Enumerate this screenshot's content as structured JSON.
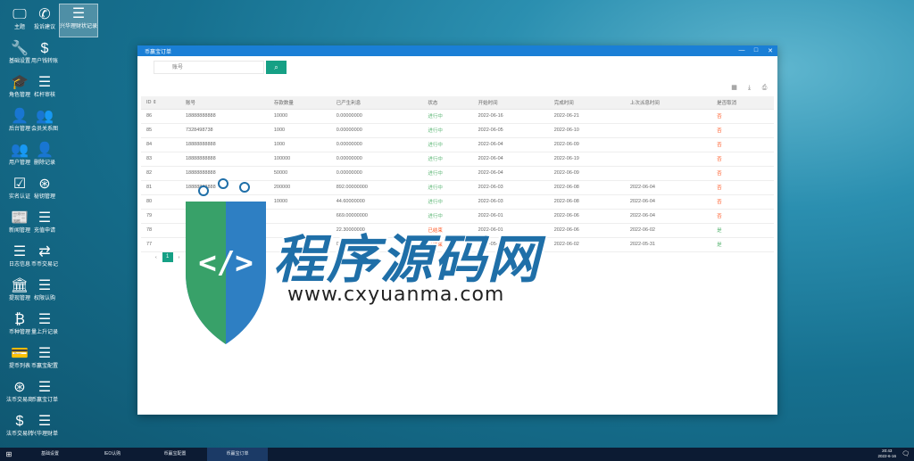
{
  "desktop": {
    "icons": [
      {
        "label": "主题",
        "glyph": "🖵"
      },
      {
        "label": "投诉建议",
        "glyph": "✆"
      },
      {
        "label": "兴华理财状记录",
        "glyph": "☰"
      },
      {
        "label": "基础设置",
        "glyph": "🔧"
      },
      {
        "label": "用户钱转账",
        "glyph": "$"
      },
      {
        "label": "角色管理",
        "glyph": "🎓"
      },
      {
        "label": "杠杆审核",
        "glyph": "☰"
      },
      {
        "label": "后台管理",
        "glyph": "👤"
      },
      {
        "label": "会员关系图",
        "glyph": "👥"
      },
      {
        "label": "用户管理",
        "glyph": "👥"
      },
      {
        "label": "删除记录",
        "glyph": "👤"
      },
      {
        "label": "实名认证",
        "glyph": "☑"
      },
      {
        "label": "秘钥管理",
        "glyph": "⊛"
      },
      {
        "label": "新闻管理",
        "glyph": "📰"
      },
      {
        "label": "充值申请",
        "glyph": "☰"
      },
      {
        "label": "日志信息",
        "glyph": "☰"
      },
      {
        "label": "币币交易记",
        "glyph": "⇄"
      },
      {
        "label": "提现管理",
        "glyph": "🏛"
      },
      {
        "label": "权限认购",
        "glyph": "☰"
      },
      {
        "label": "币种管理",
        "glyph": "₿"
      },
      {
        "label": "量上升记录",
        "glyph": "☰"
      },
      {
        "label": "提币列表",
        "glyph": "💳"
      },
      {
        "label": "币赢宝配置",
        "glyph": "☰"
      },
      {
        "label": "法币交易商",
        "glyph": "⊛"
      },
      {
        "label": "币赢宝订单",
        "glyph": "☰"
      },
      {
        "label": "法币交易转",
        "glyph": "$"
      },
      {
        "label": "兴华理财单",
        "glyph": "☰"
      }
    ]
  },
  "window": {
    "title": "币赢宝订单",
    "ctrl_min": "—",
    "ctrl_max": "□",
    "ctrl_close": "✕",
    "search": {
      "placeholder": "账号",
      "button_icon": "⌕"
    },
    "toolbar": {
      "filter_icon": "▦",
      "export_icon": "⤓",
      "print_icon": "⎙"
    },
    "table": {
      "headers": [
        "ID ⇕",
        "账号",
        "存款数量",
        "已产生利息",
        "状态",
        "开始时间",
        "完成时间",
        "上次派息时间",
        "是否取消"
      ],
      "rows": [
        [
          "86",
          "18888888888",
          "10000",
          "0.00000000",
          "进行中",
          "2022-06-16",
          "2022-06-21",
          "",
          "否"
        ],
        [
          "85",
          "7328498738",
          "1000",
          "0.00000000",
          "进行中",
          "2022-06-05",
          "2022-06-10",
          "",
          "否"
        ],
        [
          "84",
          "18888888888",
          "1000",
          "0.00000000",
          "进行中",
          "2022-06-04",
          "2022-06-09",
          "",
          "否"
        ],
        [
          "83",
          "18888888888",
          "100000",
          "0.00000000",
          "进行中",
          "2022-06-04",
          "2022-06-19",
          "",
          "否"
        ],
        [
          "82",
          "18888888888",
          "50000",
          "0.00000000",
          "进行中",
          "2022-06-04",
          "2022-06-09",
          "",
          "否"
        ],
        [
          "81",
          "18888888888",
          "200000",
          "892.00000000",
          "进行中",
          "2022-06-03",
          "2022-06-08",
          "2022-06-04",
          "否"
        ],
        [
          "80",
          "",
          "10000",
          "44.60000000",
          "进行中",
          "2022-06-03",
          "2022-06-08",
          "2022-06-04",
          "否"
        ],
        [
          "79",
          "",
          "",
          "669.00000000",
          "进行中",
          "2022-06-01",
          "2022-06-06",
          "2022-06-04",
          "否"
        ],
        [
          "78",
          "",
          "",
          "22.30000000",
          "已结束",
          "2022-06-01",
          "2022-06-06",
          "2022-06-02",
          "是"
        ],
        [
          "77",
          "",
          "",
          "0.00000000",
          "已结束",
          "2022-05-28",
          "2022-06-02",
          "2022-05-31",
          "是"
        ]
      ]
    },
    "pager": {
      "current": "1",
      "prev": "‹",
      "next": "›"
    }
  },
  "watermark": {
    "title": "程序源码网",
    "url": "www.cxyuanma.com"
  },
  "taskbar": {
    "start_icon": "⊞",
    "tasks": [
      "基础设置",
      "IEO认购",
      "币赢宝配置",
      "币赢宝订单"
    ],
    "time": "20:43",
    "date": "2022-6-16",
    "notification_icon": "🗨"
  },
  "colors": {
    "accent": "#16a085",
    "titlebar": "#1a7fd6",
    "running": "#5fb878",
    "ended": "#ff5722"
  }
}
